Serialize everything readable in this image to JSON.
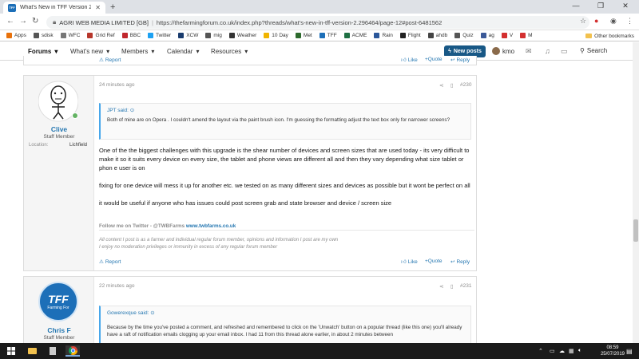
{
  "browser": {
    "tab_title": "What's New in TFF Version 2 | Fo",
    "tab_favicon": "TFF",
    "new_tab": "+",
    "win_min": "—",
    "win_max": "❐",
    "win_close": "✕",
    "site_owner": "AGRI WEB MEDIA LIMITED [GB]",
    "url": "https://thefarmingforum.co.uk/index.php?threads/what's-new-in-tff-version-2.296464/page-12#post-6481562"
  },
  "bookmarks": [
    {
      "label": "Apps",
      "color": "#e8710a"
    },
    {
      "label": "sdisk",
      "color": "#555555"
    },
    {
      "label": "WFC",
      "color": "#777777"
    },
    {
      "label": "Grid Ref",
      "color": "#b7372c"
    },
    {
      "label": "BBC",
      "color": "#c1272d"
    },
    {
      "label": "Twitter",
      "color": "#1da1f2"
    },
    {
      "label": "XCW",
      "color": "#1a3c6e"
    },
    {
      "label": "mig",
      "color": "#555555"
    },
    {
      "label": "Weather",
      "color": "#333333"
    },
    {
      "label": "10 Day",
      "color": "#f0b400"
    },
    {
      "label": "Met",
      "color": "#2d6a2d"
    },
    {
      "label": "TFF",
      "color": "#1d6fb8"
    },
    {
      "label": "ACME",
      "color": "#1f6f43"
    },
    {
      "label": "Rain",
      "color": "#2b579a"
    },
    {
      "label": "Flight",
      "color": "#222222"
    },
    {
      "label": "ahdb",
      "color": "#444444"
    },
    {
      "label": "Quiz",
      "color": "#555555"
    },
    {
      "label": "ag",
      "color": "#3b5998"
    },
    {
      "label": "V",
      "color": "#d32f2f"
    },
    {
      "label": "M",
      "color": "#d32f2f"
    }
  ],
  "bookmarks_other": "Other bookmarks",
  "nav": {
    "forums": "Forums",
    "whats_new": "What's new",
    "members": "Members",
    "calendar": "Calendar",
    "resources": "Resources",
    "new_posts": "New posts",
    "user": "kmo",
    "search": "Search"
  },
  "prev_post_actions": {
    "report": "Report",
    "like": "Like",
    "quote": "+Quote",
    "reply": "Reply"
  },
  "post1": {
    "username": "Clive",
    "role": "Staff Member",
    "location_label": "Location:",
    "location": "Lichfield",
    "time": "24 minutes ago",
    "number": "#230",
    "quote_header": "JPT said:",
    "quote_text": "Both of mine are on Opera . I couldn't amend the layout via the paint brush icon. I'm guessing the formatting adjust the text box only for narrower screens?",
    "para1": "One of the the biggest challenges with this upgrade is the shear number of devices and screen sizes that are used today - its very difficult to make it so it suits every device on every size, the tablet and phone views are different all and then they vary depending what size tablet or phon e user is on",
    "para2": "fixing for one device will mess it up for another etc. we tested on as many different sizes and devices as possible but it wont be perfect on all",
    "para3": "it would be useful if anyone who has issues could post screen grab and state browser and device / screen size",
    "follow": "Follow me on Twitter - @TWBFarms",
    "follow_link": "www.twbfarms.co.uk",
    "sig1": "All content I post is as a farmer and individual regular forum member, opinions and information I post are my own",
    "sig2": "I enjoy no moderation privileges or immunity in excess of any regular forum member",
    "report": "Report",
    "like": "Like",
    "quote": "+Quote",
    "reply": "Reply"
  },
  "post2": {
    "username": "Chris F",
    "role": "Staff Member",
    "avatar_text": "TFF",
    "avatar_sub": "Farming For",
    "time": "22 minutes ago",
    "number": "#231",
    "quote_header": "Gowerexque said:",
    "quote_text": "Because by the time you've posted a comment, and refreshed and remembered to click on the 'Unwatch' button on a popular thread (like this one) you'll already have a raft of notification emails clogging up your email inbox. I had 11 from this thread alone earlier, in about 2 minutes between"
  },
  "taskbar": {
    "time": "08:59",
    "date": "25/07/2019"
  },
  "colors": {
    "accent": "#185886",
    "link": "#2577b1",
    "username": "#2577b1",
    "online": "#63b363"
  }
}
